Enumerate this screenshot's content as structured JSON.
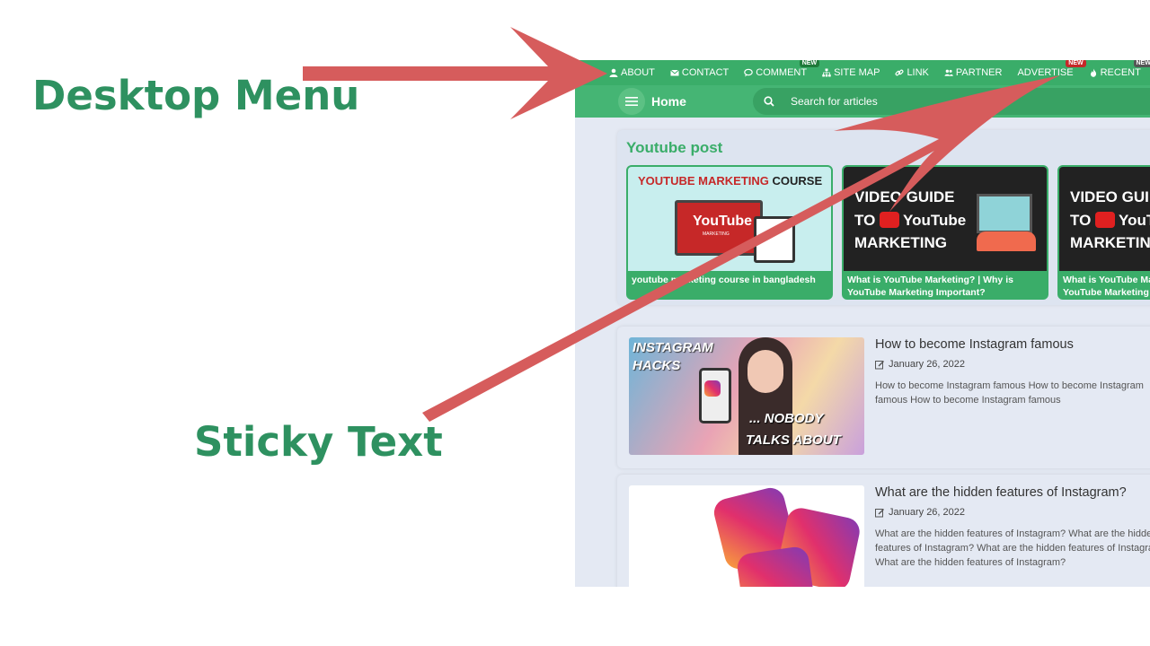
{
  "labels": {
    "desktop_menu": "Desktop Menu",
    "sticky_text": "Sticky Text"
  },
  "topnav": {
    "items": [
      {
        "label": "ABOUT",
        "icon": "user-icon"
      },
      {
        "label": "CONTACT",
        "icon": "envelope-icon"
      },
      {
        "label": "COMMENT",
        "icon": "comments-icon",
        "badge": "NEW"
      },
      {
        "label": "SITE MAP",
        "icon": "sitemap-icon"
      },
      {
        "label": "LINK",
        "icon": "link-icon"
      },
      {
        "label": "PARTNER",
        "icon": "users-icon"
      },
      {
        "label": "ADVERTISE",
        "icon": "none",
        "badge": "NEW"
      },
      {
        "label": "RECENT",
        "icon": "fire-icon",
        "badge": "NEW"
      }
    ]
  },
  "subnav": {
    "home": "Home",
    "search_placeholder": "Search for articles"
  },
  "youtube": {
    "title": "Youtube post",
    "videos": [
      {
        "thumb_title_a": "YOUTUBE MARKETING",
        "thumb_title_b": "COURSE",
        "logo": "YouTube",
        "logo_sub": "MARKETING",
        "caption": "youtube marketing course in bangladesh"
      },
      {
        "thumb_line1": "VIDEO GUIDE",
        "thumb_line2": "TO",
        "logo": "YouTube",
        "thumb_line3": "MARKETING",
        "caption": "What is YouTube Marketing? | Why is YouTube Marketing Important?"
      },
      {
        "thumb_line1": "VIDEO GUIDE",
        "thumb_line2": "TO",
        "logo": "YouTube",
        "thumb_line3": "MARKETING",
        "caption": "What is YouTube Marketing? | Why is YouTube Marketing Important?"
      }
    ]
  },
  "posts": [
    {
      "title": "How to become Instagram famous",
      "date": "January 26, 2022",
      "excerpt": "How to become Instagram famous How to become Instagram famous How to become Instagram famous",
      "thumb_top": "INSTAGRAM HACKS",
      "thumb_bottom_a": "... NOBODY",
      "thumb_bottom_b": "TALKS ABOUT"
    },
    {
      "title": "What are the hidden features of Instagram?",
      "date": "January 26, 2022",
      "excerpt": "What are the hidden features of Instagram? What are the hidden features of Instagram? What are the hidden features of Instagram? What are the hidden features of Instagram?"
    }
  ],
  "colors": {
    "accent": "#3aad69",
    "arrow": "#d65c5c",
    "label": "#2e9160"
  }
}
